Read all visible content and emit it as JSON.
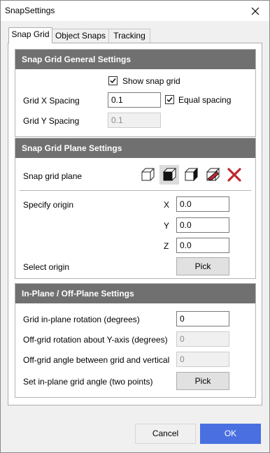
{
  "window": {
    "title": "SnapSettings"
  },
  "tabs": [
    {
      "label": "Snap Grid"
    },
    {
      "label": "Object Snaps"
    },
    {
      "label": "Tracking"
    }
  ],
  "general": {
    "header": "Snap Grid General Settings",
    "show_snap_grid_label": "Show snap grid",
    "show_snap_grid_checked": true,
    "grid_x_label": "Grid X Spacing",
    "grid_x_value": "0.1",
    "equal_spacing_label": "Equal spacing",
    "equal_spacing_checked": true,
    "grid_y_label": "Grid Y Spacing",
    "grid_y_value": "0.1"
  },
  "plane": {
    "header": "Snap Grid Plane Settings",
    "snap_grid_plane_label": "Snap grid plane",
    "plane_icons": [
      "cube-front-face-icon",
      "cube-top-face-icon",
      "cube-side-face-icon",
      "cube-angled-face-icon",
      "delete-x-icon"
    ],
    "specify_origin_label": "Specify origin",
    "x_label": "X",
    "x_value": "0.0",
    "y_label": "Y",
    "y_value": "0.0",
    "z_label": "Z",
    "z_value": "0.0",
    "select_origin_label": "Select origin",
    "pick_label": "Pick"
  },
  "inplane": {
    "header": "In-Plane / Off-Plane Settings",
    "rotation_label": "Grid in-plane rotation (degrees)",
    "rotation_value": "0",
    "offgrid_rot_label": "Off-grid rotation about Y-axis (degrees)",
    "offgrid_rot_value": "0",
    "offgrid_angle_label": "Off-grid angle between grid and vertical",
    "offgrid_angle_value": "0",
    "two_points_label": "Set in-plane grid angle (two points)",
    "pick_label": "Pick"
  },
  "footer": {
    "cancel_label": "Cancel",
    "ok_label": "OK"
  },
  "colors": {
    "header_bg": "#707070",
    "ok_bg": "#4a6fe0",
    "delete_red": "#c0282d"
  }
}
